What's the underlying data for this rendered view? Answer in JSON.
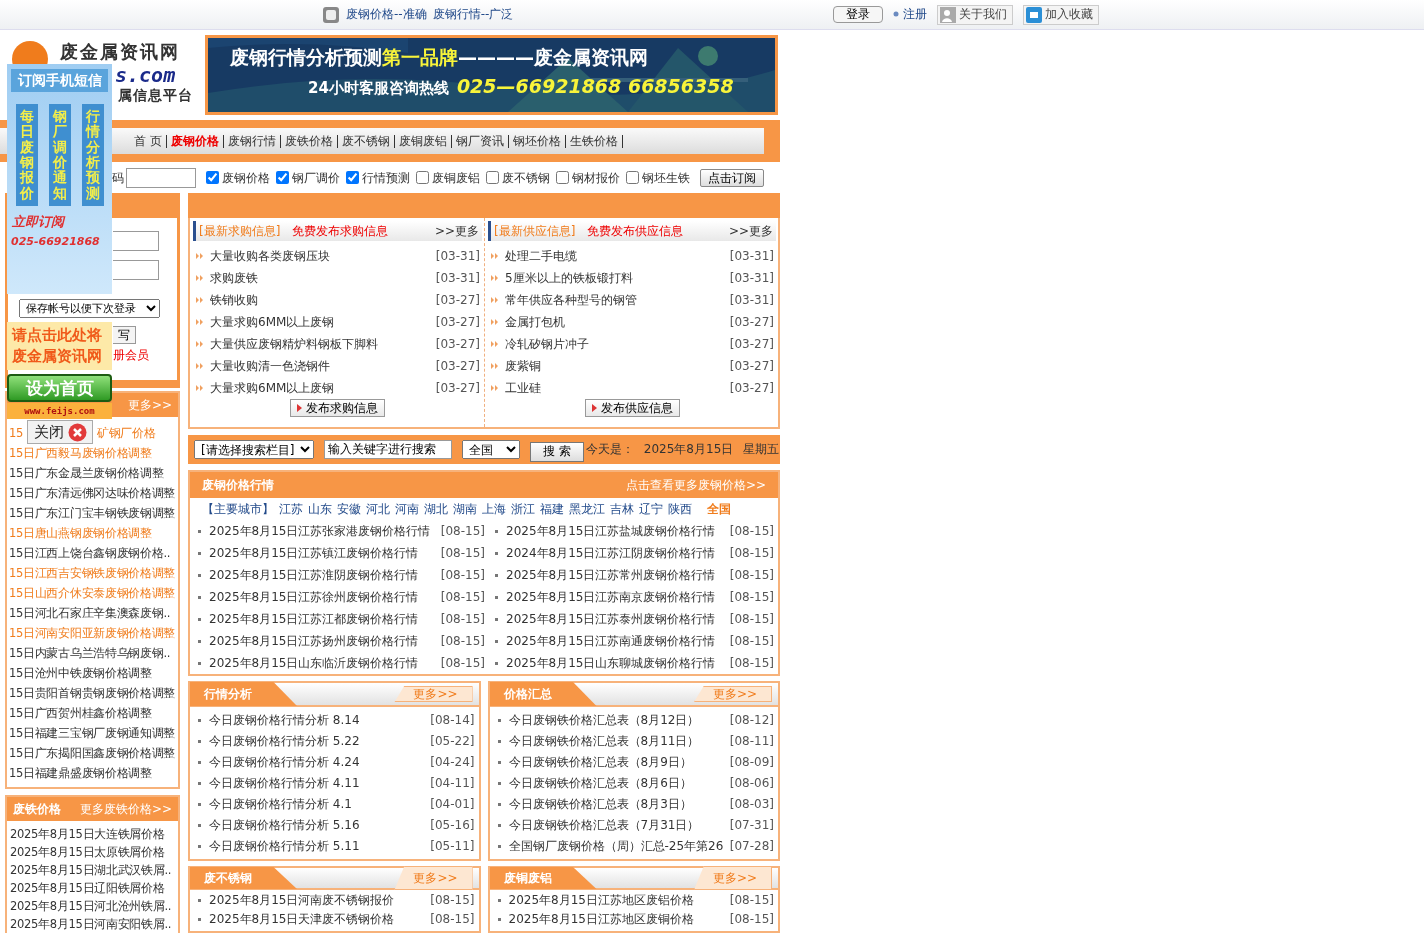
{
  "top_bar": {
    "slogans": [
      "废钢价格--准确",
      "废钢行情--广泛"
    ],
    "login_button": "登录",
    "register_link": "注册",
    "about_link": "关于我们",
    "bookmark_link": "加入收藏"
  },
  "logo": {
    "title": "废金属资讯网",
    "domain": "s.com",
    "tagline": "属信息平台"
  },
  "banner": {
    "headline": "废钢行情分析预测",
    "highlight": "第一品牌",
    "tail": "————废金属资讯网",
    "hotline_label": "24小时客服咨询热线",
    "hotline": "025—66921868  66856358"
  },
  "nav": [
    {
      "label": "首 页",
      "selected": false
    },
    {
      "label": "废钢价格",
      "selected": true
    },
    {
      "label": "废钢行情",
      "selected": false
    },
    {
      "label": "废铁价格",
      "selected": false
    },
    {
      "label": "废不锈钢",
      "selected": false
    },
    {
      "label": "废铜废铝",
      "selected": false
    },
    {
      "label": "钢厂资讯",
      "selected": false
    },
    {
      "label": "钢坯价格",
      "selected": false
    },
    {
      "label": "生铁价格",
      "selected": false
    }
  ],
  "subscribe": {
    "label_fragment": "码",
    "options": [
      {
        "label": "废钢价格",
        "checked": true
      },
      {
        "label": "钢厂调价",
        "checked": true
      },
      {
        "label": "行情预测",
        "checked": true
      },
      {
        "label": "废铜废铝",
        "checked": false
      },
      {
        "label": "废不锈钢",
        "checked": false
      },
      {
        "label": "钢材报价",
        "checked": false
      },
      {
        "label": "钢坯生铁",
        "checked": false
      }
    ],
    "button": "点击订阅"
  },
  "login": {
    "remember_select": "保存帐号以便下次登录",
    "button_fragment": "写",
    "register_fragment": "册会员"
  },
  "left_news": {
    "more": "更多>>",
    "items": [
      {
        "text": "15",
        "text_after": "矿钢厂价格",
        "color": "#f07c1c"
      },
      {
        "text": "15日广西毅马废钢价格调整",
        "color": "#f07c1c"
      },
      {
        "text": "15日广东金晟兰废钢价格调整",
        "color": "#333333"
      },
      {
        "text": "15日广东清远佛冈达味价格调整",
        "color": "#333333"
      },
      {
        "text": "15日广东江门宝丰钢铁废钢调整",
        "color": "#333333"
      },
      {
        "text": "15日唐山燕钢废钢价格调整",
        "color": "#f07c1c"
      },
      {
        "text": "15日江西上饶台鑫钢废钢价格..",
        "color": "#333333"
      },
      {
        "text": "15日江西吉安钢铁废钢价格调整",
        "color": "#f07c1c"
      },
      {
        "text": "15日山西介休安泰废钢价格调整",
        "color": "#f07c1c"
      },
      {
        "text": "15日河北石家庄辛集澳森废钢..",
        "color": "#333333"
      },
      {
        "text": "15日河南安阳亚新废钢价格调整",
        "color": "#f07c1c"
      },
      {
        "text": "15日内蒙古乌兰浩特乌钢废钢..",
        "color": "#333333"
      },
      {
        "text": "15日沧州中铁废钢价格调整",
        "color": "#333333"
      },
      {
        "text": "15日贵阳首钢贵钢废钢价格调整",
        "color": "#333333"
      },
      {
        "text": "15日广西贺州桂鑫价格调整",
        "color": "#333333"
      },
      {
        "text": "15日福建三宝钢厂废钢通知调整",
        "color": "#333333"
      },
      {
        "text": "15日广东揭阳国鑫废钢价格调整",
        "color": "#333333"
      },
      {
        "text": "15日福建鼎盛废钢价格调整",
        "color": "#333333"
      }
    ]
  },
  "iron_prices": {
    "title": "废铁价格",
    "more": "更多废铁价格>>",
    "items": [
      "2025年8月15日大连铁屑价格",
      "2025年8月15日太原铁屑价格",
      "2025年8月15日湖北武汉铁屑..",
      "2025年8月15日辽阳铁屑价格",
      "2025年8月15日河北沧州铁屑..",
      "2025年8月15日河南安阳铁屑.."
    ]
  },
  "info_panels": [
    {
      "title": "[最新求购信息]",
      "post_link": "免费发布求购信息",
      "more": ">>更多",
      "button": "发布求购信息",
      "items": [
        {
          "text": "大量收购各类废钢压块",
          "date": "[03-31]"
        },
        {
          "text": "求购废铁",
          "date": "[03-31]"
        },
        {
          "text": "铁销收购",
          "date": "[03-27]"
        },
        {
          "text": "大量求购6MM以上废钢",
          "date": "[03-27]"
        },
        {
          "text": "大量供应废钢精炉料钢板下脚料",
          "date": "[03-27]"
        },
        {
          "text": "大量收购清一色浇钢件",
          "date": "[03-27]"
        },
        {
          "text": "大量求购6MM以上废钢",
          "date": "[03-27]"
        }
      ]
    },
    {
      "title": "[最新供应信息]",
      "post_link": "免费发布供应信息",
      "more": ">>更多",
      "button": "发布供应信息",
      "items": [
        {
          "text": "处理二手电缆",
          "date": "[03-31]"
        },
        {
          "text": "5厘米以上的铁板锻打料",
          "date": "[03-31]"
        },
        {
          "text": "常年供应各种型号的钢管",
          "date": "[03-31]"
        },
        {
          "text": "金属打包机",
          "date": "[03-27]"
        },
        {
          "text": "冷轧矽钢片冲子",
          "date": "[03-27]"
        },
        {
          "text": "废紫铜",
          "date": "[03-27]"
        },
        {
          "text": "工业硅",
          "date": "[03-27]"
        }
      ]
    }
  ],
  "search": {
    "column_select": "[请选择搜索栏目]",
    "keyword": "输入关键字进行搜索",
    "region_select": "全国",
    "button": "搜 索",
    "today_label": "今天是：",
    "date": "2025年8月15日",
    "weekday": "星期五"
  },
  "scrap_prices": {
    "title": "废钢价格行情",
    "more": "点击查看更多废钢价格>>",
    "cities_label": "【主要城市】",
    "cities": [
      {
        "name": "江苏",
        "selected": false
      },
      {
        "name": "山东",
        "selected": false
      },
      {
        "name": "安徽",
        "selected": false
      },
      {
        "name": "河北",
        "selected": false
      },
      {
        "name": "河南",
        "selected": false
      },
      {
        "name": "湖北",
        "selected": false
      },
      {
        "name": "湖南",
        "selected": false
      },
      {
        "name": "上海",
        "selected": false
      },
      {
        "name": "浙江",
        "selected": false
      },
      {
        "name": "福建",
        "selected": false
      },
      {
        "name": "黑龙江",
        "selected": false
      },
      {
        "name": "吉林",
        "selected": false
      },
      {
        "name": "辽宁",
        "selected": false
      },
      {
        "name": "陕西",
        "selected": false
      },
      {
        "name": "全国",
        "selected": true
      }
    ],
    "rows": [
      {
        "text": "2025年8月15日江苏张家港废钢价格行情",
        "date": "[08-15]"
      },
      {
        "text": "2025年8月15日江苏盐城废钢价格行情",
        "date": "[08-15]"
      },
      {
        "text": "2025年8月15日江苏镇江废钢价格行情",
        "date": "[08-15]"
      },
      {
        "text": "2024年8月15日江苏江阴废钢价格行情",
        "date": "[08-15]"
      },
      {
        "text": "2025年8月15日江苏淮阴废钢价格行情",
        "date": "[08-15]"
      },
      {
        "text": "2025年8月15日江苏常州废钢价格行情",
        "date": "[08-15]"
      },
      {
        "text": "2025年8月15日江苏徐州废钢价格行情",
        "date": "[08-15]"
      },
      {
        "text": "2025年8月15日江苏南京废钢价格行情",
        "date": "[08-15]"
      },
      {
        "text": "2025年8月15日江苏江都废钢价格行情",
        "date": "[08-15]"
      },
      {
        "text": "2025年8月15日江苏泰州废钢价格行情",
        "date": "[08-15]"
      },
      {
        "text": "2025年8月15日江苏扬州废钢价格行情",
        "date": "[08-15]"
      },
      {
        "text": "2025年8月15日江苏南通废钢价格行情",
        "date": "[08-15]"
      },
      {
        "text": "2025年8月15日山东临沂废钢价格行情",
        "date": "[08-15]"
      },
      {
        "text": "2025年8月15日山东聊城废钢价格行情",
        "date": "[08-15]"
      }
    ]
  },
  "sections": [
    {
      "title": "行情分析",
      "more": "更多>>",
      "items": [
        {
          "text": "今日废钢价格行情分析 8.14",
          "date": "[08-14]"
        },
        {
          "text": "今日废钢价格行情分析 5.22",
          "date": "[05-22]"
        },
        {
          "text": "今日废钢价格行情分析 4.24",
          "date": "[04-24]"
        },
        {
          "text": "今日废钢价格行情分析 4.11",
          "date": "[04-11]"
        },
        {
          "text": "今日废钢价格行情分析 4.1",
          "date": "[04-01]"
        },
        {
          "text": "今日废钢价格行情分析 5.16",
          "date": "[05-16]"
        },
        {
          "text": "今日废钢价格行情分析 5.11",
          "date": "[05-11]"
        }
      ]
    },
    {
      "title": "价格汇总",
      "more": "更多>>",
      "items": [
        {
          "text": "今日废钢铁价格汇总表（8月12日）",
          "date": "[08-12]"
        },
        {
          "text": "今日废钢铁价格汇总表（8月11日）",
          "date": "[08-11]"
        },
        {
          "text": "今日废钢铁价格汇总表（8月9日）",
          "date": "[08-09]"
        },
        {
          "text": "今日废钢铁价格汇总表（8月6日）",
          "date": "[08-06]"
        },
        {
          "text": "今日废钢铁价格汇总表（8月3日）",
          "date": "[08-03]"
        },
        {
          "text": "今日废钢铁价格汇总表（7月31日）",
          "date": "[07-31]"
        },
        {
          "text": "全国钢厂废钢价格（周）汇总-25年第26",
          "date": "[07-28]"
        }
      ]
    },
    {
      "title": "废不锈钢",
      "more": "更多>>",
      "items": [
        {
          "text": "2025年8月15日河南废不锈钢报价",
          "date": "[08-15]"
        },
        {
          "text": "2025年8月15日天津废不锈钢价格",
          "date": "[08-15]"
        }
      ]
    },
    {
      "title": "废铜废铝",
      "more": "更多>>",
      "items": [
        {
          "text": "2025年8月15日江苏地区废铝价格",
          "date": "[08-15]"
        },
        {
          "text": "2025年8月15日江苏地区废铜价格",
          "date": "[08-15]"
        }
      ]
    }
  ],
  "overlays": {
    "sms_ad": {
      "title": "订阅手机短信",
      "columns": [
        "每日废钢报价",
        "钢厂调价通知",
        "行情分析预测"
      ],
      "cta": "立即订阅",
      "phone": "025-66921868"
    },
    "homepage_ad": {
      "lines": [
        "请点击此处将",
        "废金属资讯网"
      ],
      "button": "设为首页",
      "url": "www.feijs.com"
    },
    "close_button": "关闭"
  }
}
